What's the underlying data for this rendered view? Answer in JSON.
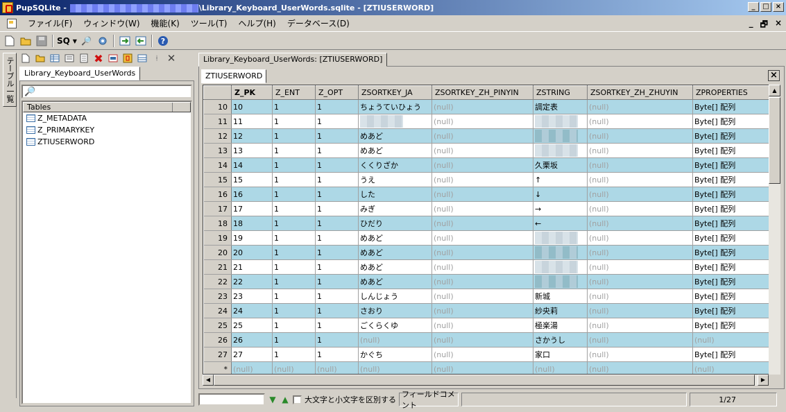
{
  "window": {
    "title_prefix": "PupSQLite - ",
    "title_suffix": "\\Library_Keyboard_UserWords.sqlite - [ZTIUSERWORD]",
    "min": "_",
    "max": "□",
    "close": "×"
  },
  "menu": {
    "items": [
      "ファイル(F)",
      "ウィンドウ(W)",
      "機能(K)",
      "ツール(T)",
      "ヘルプ(H)",
      "データベース(D)"
    ],
    "mdi_min": "_",
    "mdi_restore": "🗗",
    "mdi_close": "×"
  },
  "toolbar": {
    "sql_label": "SQ",
    "icons": [
      "new-file-icon",
      "open-folder-icon",
      "save-icon",
      "sql-icon",
      "dropdown-arrow-icon",
      "search-icon",
      "settings-icon",
      "export-icon",
      "import-icon",
      "help-icon"
    ]
  },
  "sidebar": {
    "vertical_tab_label": "テーブル一覧",
    "tab_label": "Library_Keyboard_UserWords",
    "search_icon": "🔎",
    "list_header": "Tables",
    "tables": [
      "Z_METADATA",
      "Z_PRIMARYKEY",
      "ZTIUSERWORD"
    ]
  },
  "document": {
    "tab_label": "Library_Keyboard_UserWords: [ZTIUSERWORD]",
    "table_tab_label": "ZTIUSERWORD",
    "close_label": "×"
  },
  "grid": {
    "columns": [
      "Z_PK",
      "Z_ENT",
      "Z_OPT",
      "ZSORTKEY_JA",
      "ZSORTKEY_ZH_PINYIN",
      "ZSTRING",
      "ZSORTKEY_ZH_ZHUYIN",
      "ZPROPERTIES"
    ],
    "null_text": "(null)",
    "new_row_marker": "*",
    "rows": [
      {
        "n": "10",
        "pk": "10",
        "ent": "1",
        "opt": "1",
        "ja": "ちょうていひょう",
        "py": "(null)",
        "str": "調定表",
        "zy": "(null)",
        "prop": "Byte[] 配列"
      },
      {
        "n": "11",
        "pk": "11",
        "ent": "1",
        "opt": "1",
        "ja": "",
        "py": "(null)",
        "str": "",
        "zy": "(null)",
        "prop": "Byte[] 配列"
      },
      {
        "n": "12",
        "pk": "12",
        "ent": "1",
        "opt": "1",
        "ja": "めあど",
        "py": "(null)",
        "str": "",
        "zy": "(null)",
        "prop": "Byte[] 配列"
      },
      {
        "n": "13",
        "pk": "13",
        "ent": "1",
        "opt": "1",
        "ja": "めあど",
        "py": "(null)",
        "str": "",
        "zy": "(null)",
        "prop": "Byte[] 配列"
      },
      {
        "n": "14",
        "pk": "14",
        "ent": "1",
        "opt": "1",
        "ja": "くくりざか",
        "py": "(null)",
        "str": "久栗坂",
        "zy": "(null)",
        "prop": "Byte[] 配列"
      },
      {
        "n": "15",
        "pk": "15",
        "ent": "1",
        "opt": "1",
        "ja": "うえ",
        "py": "(null)",
        "str": "↑",
        "zy": "(null)",
        "prop": "Byte[] 配列"
      },
      {
        "n": "16",
        "pk": "16",
        "ent": "1",
        "opt": "1",
        "ja": "した",
        "py": "(null)",
        "str": "↓",
        "zy": "(null)",
        "prop": "Byte[] 配列"
      },
      {
        "n": "17",
        "pk": "17",
        "ent": "1",
        "opt": "1",
        "ja": "みぎ",
        "py": "(null)",
        "str": "→",
        "zy": "(null)",
        "prop": "Byte[] 配列"
      },
      {
        "n": "18",
        "pk": "18",
        "ent": "1",
        "opt": "1",
        "ja": "ひだり",
        "py": "(null)",
        "str": "←",
        "zy": "(null)",
        "prop": "Byte[] 配列"
      },
      {
        "n": "19",
        "pk": "19",
        "ent": "1",
        "opt": "1",
        "ja": "めあど",
        "py": "(null)",
        "str": "",
        "zy": "(null)",
        "prop": "Byte[] 配列"
      },
      {
        "n": "20",
        "pk": "20",
        "ent": "1",
        "opt": "1",
        "ja": "めあど",
        "py": "(null)",
        "str": "",
        "zy": "(null)",
        "prop": "Byte[] 配列"
      },
      {
        "n": "21",
        "pk": "21",
        "ent": "1",
        "opt": "1",
        "ja": "めあど",
        "py": "(null)",
        "str": "",
        "zy": "(null)",
        "prop": "Byte[] 配列"
      },
      {
        "n": "22",
        "pk": "22",
        "ent": "1",
        "opt": "1",
        "ja": "めあど",
        "py": "(null)",
        "str": "",
        "zy": "(null)",
        "prop": "Byte[] 配列"
      },
      {
        "n": "23",
        "pk": "23",
        "ent": "1",
        "opt": "1",
        "ja": "しんじょう",
        "py": "(null)",
        "str": "新城",
        "zy": "(null)",
        "prop": "Byte[] 配列"
      },
      {
        "n": "24",
        "pk": "24",
        "ent": "1",
        "opt": "1",
        "ja": "さおり",
        "py": "(null)",
        "str": "紗央莉",
        "zy": "(null)",
        "prop": "Byte[] 配列"
      },
      {
        "n": "25",
        "pk": "25",
        "ent": "1",
        "opt": "1",
        "ja": "ごくらくゆ",
        "py": "(null)",
        "str": "極楽湯",
        "zy": "(null)",
        "prop": "Byte[] 配列"
      },
      {
        "n": "26",
        "pk": "26",
        "ent": "1",
        "opt": "1",
        "ja": "(null)",
        "py": "(null)",
        "str": "さかうし",
        "zy": "(null)",
        "prop": "(null)"
      },
      {
        "n": "27",
        "pk": "27",
        "ent": "1",
        "opt": "1",
        "ja": "かぐち",
        "py": "(null)",
        "str": "家口",
        "zy": "(null)",
        "prop": "Byte[] 配列"
      },
      {
        "n": "*",
        "pk": "(null)",
        "ent": "(null)",
        "opt": "(null)",
        "ja": "(null)",
        "py": "(null)",
        "str": "(null)",
        "zy": "(null)",
        "prop": "(null)"
      }
    ]
  },
  "status": {
    "case_sensitive_label": "大文字と小文字を区別する",
    "field_comment_label": "フィールドコメント",
    "position": "1/27"
  },
  "colors": {
    "alt_row": "#add8e6",
    "title_gradient_start": "#0a246a",
    "null_text": "#a0a0a0"
  }
}
